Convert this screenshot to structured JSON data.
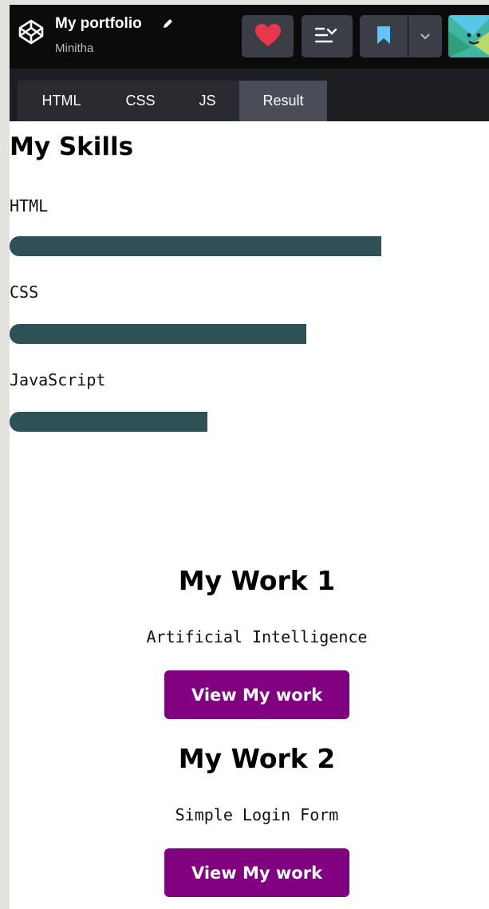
{
  "header": {
    "title": "My portfolio",
    "author": "Minitha",
    "icons": [
      "codepen-logo-icon",
      "pencil-icon",
      "heart-icon",
      "layout-icon",
      "bookmark-icon",
      "chevron-down-icon",
      "avatar"
    ],
    "colors": {
      "heart": "#e8374d",
      "bookmark": "#5fc4ff"
    }
  },
  "tabs": [
    {
      "label": "HTML"
    },
    {
      "label": "CSS"
    },
    {
      "label": "JS"
    },
    {
      "label": "Result"
    }
  ],
  "result": {
    "skills_title": "My Skills",
    "skills": [
      {
        "label": "HTML",
        "level": 0.79
      },
      {
        "label": "CSS",
        "level": 0.63
      },
      {
        "label": "JavaScript",
        "level": 0.42
      }
    ],
    "works": [
      {
        "title": "My Work 1",
        "subtitle": "Artificial Intelligence",
        "button": "View My work"
      },
      {
        "title": "My Work 2",
        "subtitle": "Simple Login Form",
        "button": "View My work"
      }
    ],
    "colors": {
      "bar": "#2e5155",
      "button": "#800080"
    }
  }
}
